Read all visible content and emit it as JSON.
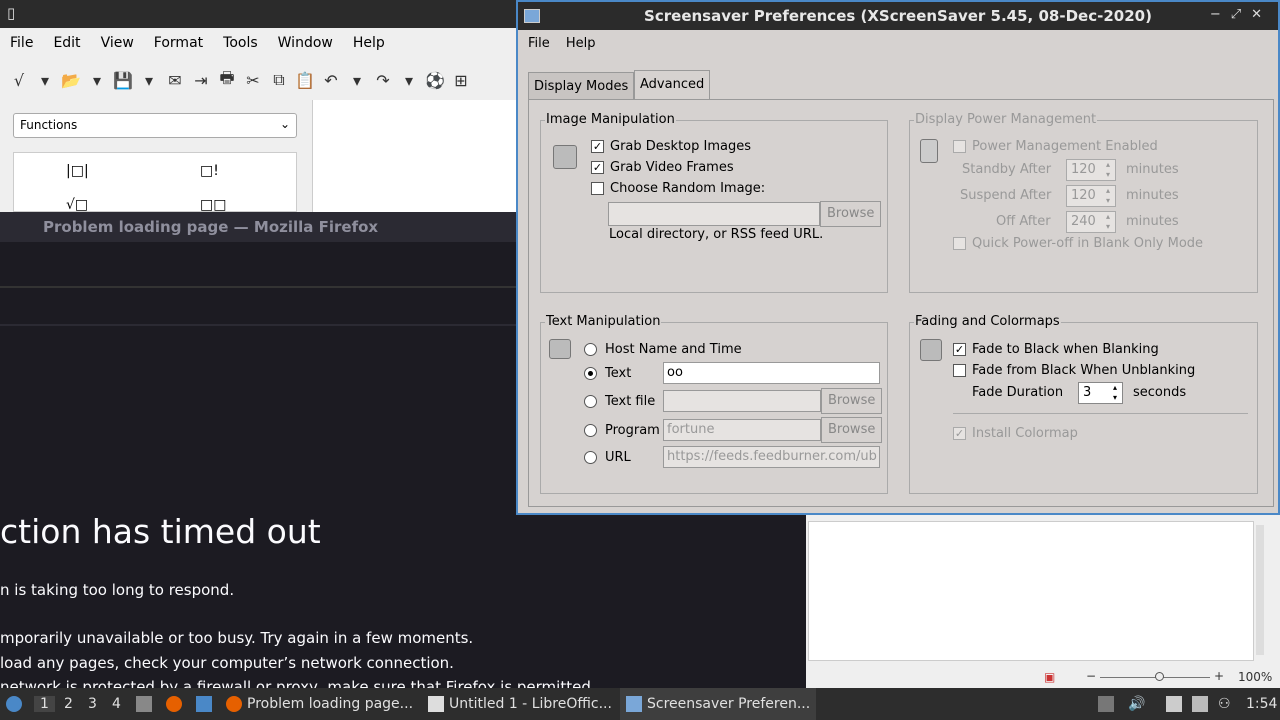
{
  "libreoffice": {
    "title_icon": "document-icon",
    "menu": [
      "File",
      "Edit",
      "View",
      "Format",
      "Tools",
      "Window",
      "Help"
    ],
    "tool_icons": [
      "√",
      "▾",
      "📂",
      "▾",
      "💾",
      "▾",
      "✉",
      "⇥",
      "🖶",
      "✂",
      "⧉",
      "📋",
      "↶",
      "▾",
      "↷",
      "▾",
      "⚽",
      "⊞"
    ],
    "functions_label": "Functions",
    "panel_symbols": [
      "|□|",
      "□!",
      "√□",
      "□□"
    ],
    "status_zoom": "100%"
  },
  "firefox": {
    "window_title": "Problem loading page — Mozilla Firefox",
    "heading": "ction has timed out",
    "lines": [
      "n is taking too long to respond.",
      "mporarily unavailable or too busy. Try again in a few moments.",
      "load any pages, check your computer’s network connection.",
      "network is protected by a firewall or proxy, make sure that Firefox is permitted"
    ]
  },
  "xscreensaver": {
    "title": "Screensaver Preferences  (XScreenSaver 5.45, 08-Dec-2020)",
    "menu": [
      "File",
      "Help"
    ],
    "tabs": [
      "Display Modes",
      "Advanced"
    ],
    "image_group": {
      "label": "Image Manipulation",
      "grab_desktop": "Grab Desktop Images",
      "grab_video": "Grab Video Frames",
      "choose_random": "Choose Random Image:",
      "browse": "Browse",
      "hint": "Local directory, or RSS feed URL."
    },
    "power_group": {
      "label": "Display Power Management",
      "enabled": "Power Management Enabled",
      "standby": "Standby After",
      "standby_val": "120",
      "suspend": "Suspend After",
      "suspend_val": "120",
      "off": "Off After",
      "off_val": "240",
      "minutes": "minutes",
      "quick": "Quick Power-off in Blank Only Mode"
    },
    "text_group": {
      "label": "Text Manipulation",
      "host": "Host Name and Time",
      "text": "Text",
      "text_val": "oo",
      "textfile": "Text file",
      "program": "Program",
      "program_val": "fortune",
      "url": "URL",
      "url_val": "https://feeds.feedburner.com/ub",
      "browse": "Browse"
    },
    "fade_group": {
      "label": "Fading and Colormaps",
      "fade_black": "Fade to Black when Blanking",
      "fade_from": "Fade from Black When Unblanking",
      "duration": "Fade Duration",
      "duration_val": "3",
      "seconds": "seconds",
      "install": "Install Colormap"
    }
  },
  "taskbar": {
    "workspaces": [
      "1",
      "2",
      "3",
      "4"
    ],
    "tasks": [
      "Problem loading page...",
      "Untitled 1 - LibreOffic...",
      "Screensaver Preferen..."
    ],
    "clock": "1:54"
  }
}
